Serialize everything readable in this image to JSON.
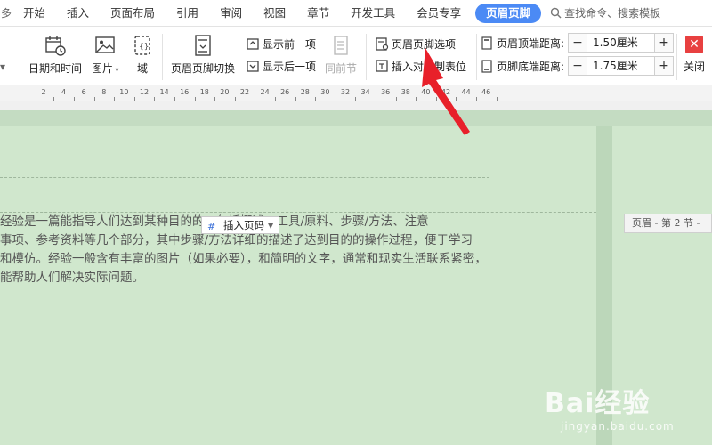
{
  "menubar": {
    "left_edge": "多",
    "tabs": [
      "开始",
      "插入",
      "页面布局",
      "引用",
      "审阅",
      "视图",
      "章节",
      "开发工具",
      "会员专享",
      "页眉页脚"
    ],
    "active_tab": "页眉页脚",
    "search_text": "查找命令、搜索模板"
  },
  "ribbon": {
    "date_time": "日期和时间",
    "picture": "图片",
    "field": "域",
    "switch": "页眉页脚切换",
    "show_prev": "显示前一项",
    "show_next": "显示后一项",
    "same_prev": "同前节",
    "options": "页眉页脚选项",
    "insert_align": "插入对齐制表位",
    "header_top_label": "页眉顶端距离:",
    "header_top_value": "1.50厘米",
    "footer_bottom_label": "页脚底端距离:",
    "footer_bottom_value": "1.75厘米",
    "close": "关闭"
  },
  "ruler": {
    "ticks": [
      "2",
      "4",
      "6",
      "8",
      "10",
      "12",
      "14",
      "16",
      "18",
      "20",
      "22",
      "24",
      "26",
      "28",
      "30",
      "32",
      "34",
      "36",
      "38",
      "40",
      "42",
      "44",
      "46"
    ]
  },
  "document": {
    "insert_page_number": "插入页码",
    "lines": [
      "经验是一篇能指导人们达到某种目的的，包括概述、工具/原料、步骤/方法、注意",
      "事项、参考资料等几个部分，其中步骤/方法详细的描述了达到目的的操作过程，便于学习",
      "和模仿。经验一般含有丰富的图片（如果必要），和简明的文字，通常和现实生活联系紧密，",
      "能帮助人们解决实际问题。"
    ],
    "header_tag": "页眉 - 第 2 节 -"
  },
  "watermark": {
    "logo": "Bai经验",
    "url": "jingyan.baidu.com"
  },
  "colors": {
    "accent": "#4b8af5",
    "doc_background": "#cfe6cc",
    "arrow": "#e8202a",
    "close": "#e84040"
  }
}
